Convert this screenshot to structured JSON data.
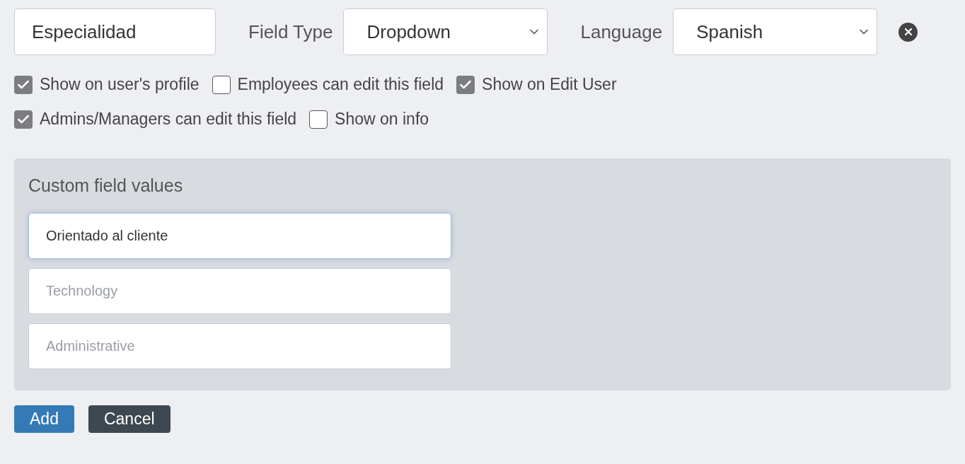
{
  "name_field": {
    "value": "Especialidad"
  },
  "field_type": {
    "label": "Field Type",
    "value": "Dropdown"
  },
  "language": {
    "label": "Language",
    "value": "Spanish"
  },
  "option_rows": [
    {
      "items": [
        {
          "label": "Show on user's profile",
          "checked": true
        },
        {
          "label": "Employees can edit this field",
          "checked": false
        },
        {
          "label": "Show on Edit User",
          "checked": true
        }
      ]
    },
    {
      "items": [
        {
          "label": "Admins/Managers can edit this field",
          "checked": true
        },
        {
          "label": "Show on info",
          "checked": false
        }
      ]
    }
  ],
  "custom_values": {
    "title": "Custom field values",
    "fields": [
      {
        "value": "Orientado al cliente",
        "focused": true
      },
      {
        "placeholder": "Technology",
        "focused": false
      },
      {
        "placeholder": "Administrative",
        "focused": false
      }
    ]
  },
  "buttons": [
    {
      "label": "Add",
      "kind": "primary"
    },
    {
      "label": "Cancel",
      "kind": "secondary"
    }
  ]
}
